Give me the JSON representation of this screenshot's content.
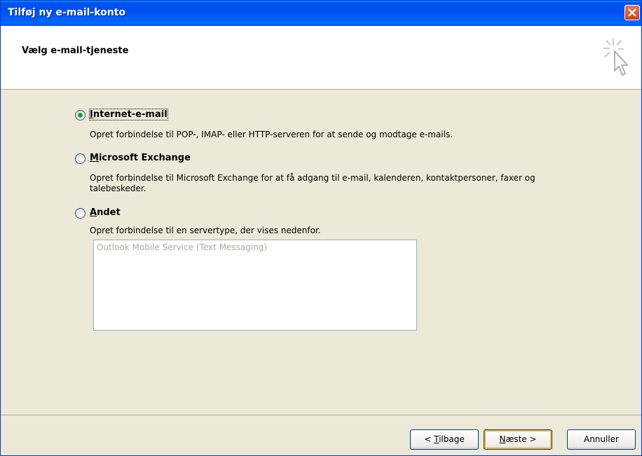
{
  "window": {
    "title": "Tilføj ny e-mail-konto"
  },
  "header": {
    "heading": "Vælg e-mail-tjeneste"
  },
  "options": [
    {
      "label": "Internet-e-mail",
      "mnemonic": "I",
      "rest": "nternet-e-mail",
      "checked": true,
      "desc": [
        "Opret forbindelse til POP-, IMAP- eller HTTP-serveren for at sende og modtage e-mails."
      ]
    },
    {
      "label": "Microsoft Exchange",
      "mnemonic": "M",
      "rest": "icrosoft Exchange",
      "checked": false,
      "desc": [
        "Opret forbindelse til Microsoft Exchange for at få adgang til e-mail, kalenderen, kontaktpersoner, faxer og",
        "talebeskeder."
      ]
    },
    {
      "label": "Andet",
      "mnemonic": "A",
      "rest": "ndet",
      "checked": false,
      "desc": [
        "Opret forbindelse til en servertype, der vises nedenfor."
      ]
    }
  ],
  "server_list": {
    "items": [
      "Outlook Mobile Service (Text Messaging)"
    ]
  },
  "buttons": {
    "back": {
      "pre": "< ",
      "mnemonic": "T",
      "rest": "ilbage"
    },
    "next": {
      "mnemonic": "N",
      "rest": "æste >"
    },
    "cancel": {
      "label": "Annuller"
    }
  },
  "icons": {
    "close": "close-icon",
    "wizard": "cursor-sparkle-icon"
  },
  "colors": {
    "titlebar": "#0055ea",
    "panel": "#ece9d8",
    "radio_check": "#21a121",
    "default_button_glow": "#f8b330"
  }
}
